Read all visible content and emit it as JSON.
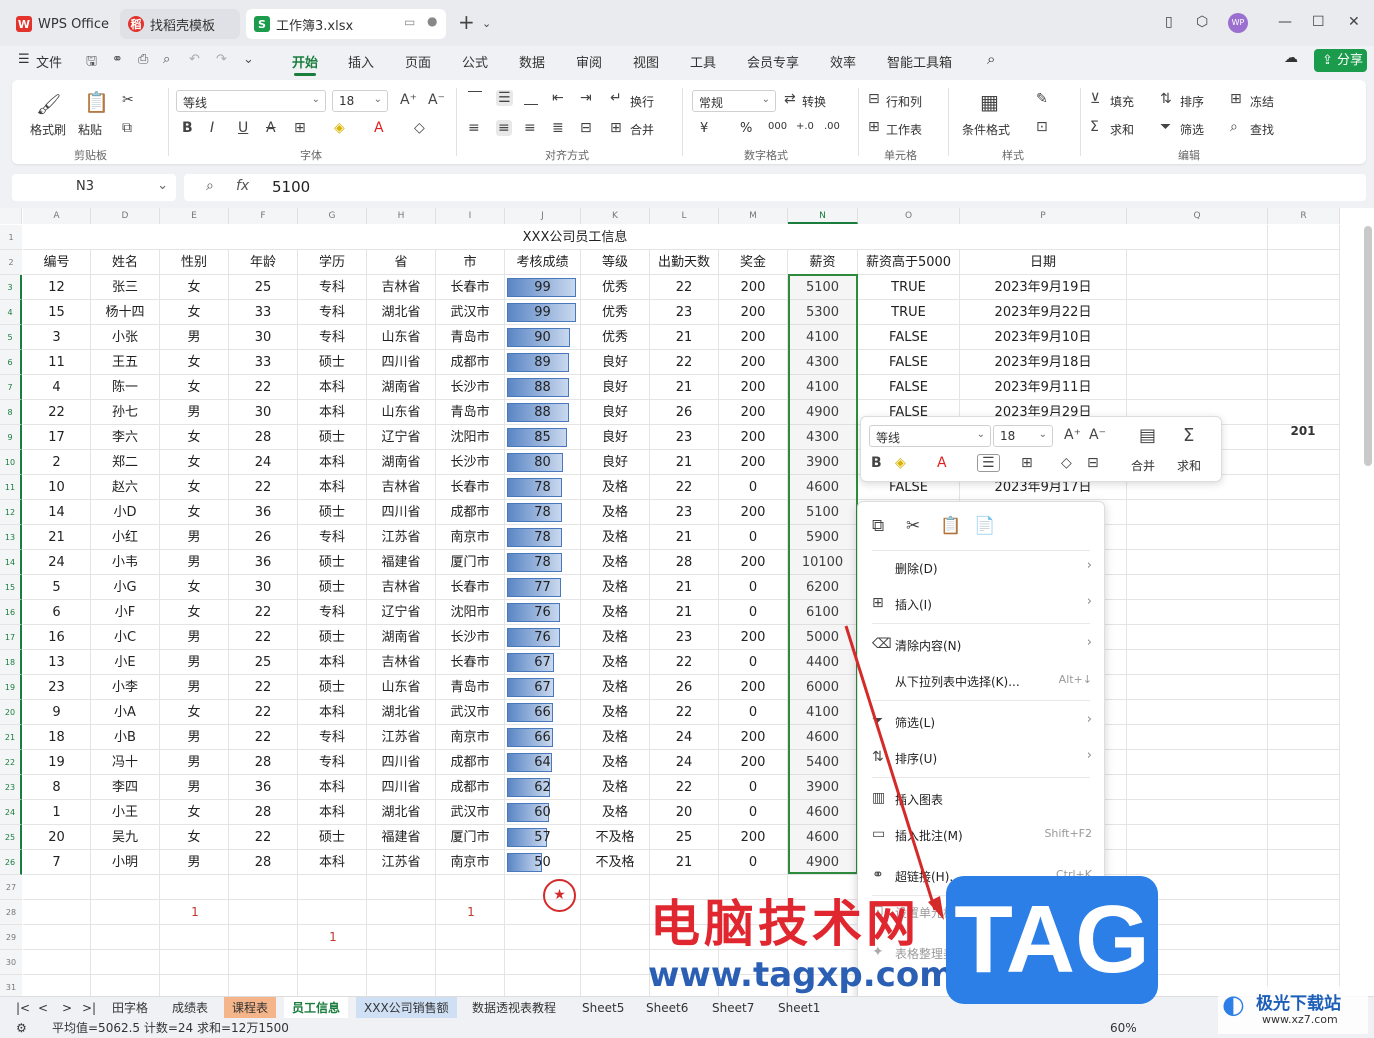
{
  "tabs": [
    {
      "label": "WPS Office",
      "logo": "W"
    },
    {
      "label": "找稻壳模板",
      "logo": "稻"
    },
    {
      "label": "工作簿3.xlsx",
      "logo": "S"
    }
  ],
  "menu": {
    "file": "文件",
    "items": [
      "开始",
      "插入",
      "页面",
      "公式",
      "数据",
      "审阅",
      "视图",
      "工具",
      "会员专享",
      "效率",
      "智能工具箱"
    ],
    "share": "分享"
  },
  "ribbon": {
    "clipboard": {
      "brush": "格式刷",
      "paste": "粘贴",
      "group": "剪贴板"
    },
    "font": {
      "name": "等线",
      "size": "18",
      "group": "字体"
    },
    "align": {
      "wrap": "换行",
      "merge": "合并",
      "group": "对齐方式"
    },
    "number": {
      "format": "常规",
      "convert": "转换",
      "group": "数字格式",
      "yen": "¥",
      "pct": "%",
      "thousand": "000",
      "inc": "+.0",
      "dec": ".00"
    },
    "cells": {
      "rowcol": "行和列",
      "sheet": "工作表",
      "group": "单元格"
    },
    "styles": {
      "cond": "条件格式",
      "group": "样式"
    },
    "edit": {
      "fill": "填充",
      "sort": "排序",
      "freeze": "冻结",
      "sum": "求和",
      "filter": "筛选",
      "find": "查找",
      "group": "编辑"
    }
  },
  "formula": {
    "name": "N3",
    "fx": "fx",
    "value": "5100"
  },
  "columns": [
    "A",
    "D",
    "E",
    "F",
    "G",
    "H",
    "I",
    "J",
    "K",
    "L",
    "M",
    "N",
    "O",
    "P",
    "Q",
    "R"
  ],
  "title_row": "XXX公司员工信息",
  "headers": [
    "编号",
    "姓名",
    "性别",
    "年龄",
    "学历",
    "省",
    "市",
    "考核成绩",
    "等级",
    "出勤天数",
    "奖金",
    "薪资",
    "薪资高于5000",
    "日期"
  ],
  "rows": [
    [
      "12",
      "张三",
      "女",
      "25",
      "专科",
      "吉林省",
      "长春市",
      "99",
      "优秀",
      "22",
      "200",
      "5100",
      "TRUE",
      "2023年9月19日"
    ],
    [
      "15",
      "杨十四",
      "女",
      "33",
      "专科",
      "湖北省",
      "武汉市",
      "99",
      "优秀",
      "23",
      "200",
      "5300",
      "TRUE",
      "2023年9月22日"
    ],
    [
      "3",
      "小张",
      "男",
      "30",
      "专科",
      "山东省",
      "青岛市",
      "90",
      "优秀",
      "21",
      "200",
      "4100",
      "FALSE",
      "2023年9月10日"
    ],
    [
      "11",
      "王五",
      "女",
      "33",
      "硕士",
      "四川省",
      "成都市",
      "89",
      "良好",
      "22",
      "200",
      "4300",
      "FALSE",
      "2023年9月18日"
    ],
    [
      "4",
      "陈一",
      "女",
      "22",
      "本科",
      "湖南省",
      "长沙市",
      "88",
      "良好",
      "21",
      "200",
      "4100",
      "FALSE",
      "2023年9月11日"
    ],
    [
      "22",
      "孙七",
      "男",
      "30",
      "本科",
      "山东省",
      "青岛市",
      "88",
      "良好",
      "26",
      "200",
      "4900",
      "FALSE",
      "2023年9月29日"
    ],
    [
      "17",
      "李六",
      "女",
      "28",
      "硕士",
      "辽宁省",
      "沈阳市",
      "85",
      "良好",
      "23",
      "200",
      "4300",
      "",
      ""
    ],
    [
      "2",
      "郑二",
      "女",
      "24",
      "本科",
      "湖南省",
      "长沙市",
      "80",
      "良好",
      "21",
      "200",
      "3900",
      "",
      ""
    ],
    [
      "10",
      "赵六",
      "女",
      "22",
      "本科",
      "吉林省",
      "长春市",
      "78",
      "及格",
      "22",
      "0",
      "4600",
      "FALSE",
      "2023年9月17日"
    ],
    [
      "14",
      "小D",
      "女",
      "36",
      "硕士",
      "四川省",
      "成都市",
      "78",
      "及格",
      "23",
      "200",
      "5100",
      "",
      ""
    ],
    [
      "21",
      "小红",
      "男",
      "26",
      "专科",
      "江苏省",
      "南京市",
      "78",
      "及格",
      "21",
      "0",
      "5900",
      "",
      ""
    ],
    [
      "24",
      "小韦",
      "男",
      "36",
      "硕士",
      "福建省",
      "厦门市",
      "78",
      "及格",
      "28",
      "200",
      "10100",
      "",
      ""
    ],
    [
      "5",
      "小G",
      "女",
      "30",
      "硕士",
      "吉林省",
      "长春市",
      "77",
      "及格",
      "21",
      "0",
      "6200",
      "",
      ""
    ],
    [
      "6",
      "小F",
      "女",
      "22",
      "专科",
      "辽宁省",
      "沈阳市",
      "76",
      "及格",
      "21",
      "0",
      "6100",
      "",
      ""
    ],
    [
      "16",
      "小C",
      "男",
      "22",
      "硕士",
      "湖南省",
      "长沙市",
      "76",
      "及格",
      "23",
      "200",
      "5000",
      "",
      ""
    ],
    [
      "13",
      "小E",
      "男",
      "25",
      "本科",
      "吉林省",
      "长春市",
      "67",
      "及格",
      "22",
      "0",
      "4400",
      "",
      ""
    ],
    [
      "23",
      "小李",
      "男",
      "22",
      "硕士",
      "山东省",
      "青岛市",
      "67",
      "及格",
      "26",
      "200",
      "6000",
      "",
      ""
    ],
    [
      "9",
      "小A",
      "女",
      "22",
      "本科",
      "湖北省",
      "武汉市",
      "66",
      "及格",
      "22",
      "0",
      "4100",
      "",
      ""
    ],
    [
      "18",
      "小B",
      "男",
      "22",
      "专科",
      "江苏省",
      "南京市",
      "66",
      "及格",
      "24",
      "200",
      "4600",
      "",
      ""
    ],
    [
      "19",
      "冯十",
      "男",
      "28",
      "专科",
      "四川省",
      "成都市",
      "64",
      "及格",
      "24",
      "200",
      "5400",
      "",
      ""
    ],
    [
      "8",
      "李四",
      "男",
      "36",
      "本科",
      "四川省",
      "成都市",
      "62",
      "及格",
      "22",
      "0",
      "3900",
      "",
      ""
    ],
    [
      "1",
      "小王",
      "女",
      "28",
      "本科",
      "湖北省",
      "武汉市",
      "60",
      "及格",
      "20",
      "0",
      "4600",
      "",
      ""
    ],
    [
      "20",
      "吴九",
      "女",
      "22",
      "硕士",
      "福建省",
      "厦门市",
      "57",
      "不及格",
      "25",
      "200",
      "4600",
      "",
      ""
    ],
    [
      "7",
      "小明",
      "男",
      "28",
      "本科",
      "江苏省",
      "南京市",
      "50",
      "不及格",
      "21",
      "0",
      "4900",
      "",
      ""
    ]
  ],
  "row_numbers": [
    "1",
    "2",
    "3",
    "4",
    "5",
    "6",
    "7",
    "8",
    "9",
    "10",
    "11",
    "12",
    "13",
    "14",
    "15",
    "16",
    "17",
    "18",
    "19",
    "20",
    "21",
    "22",
    "23",
    "24",
    "25",
    "26",
    "27",
    "28",
    "29",
    "30",
    "31"
  ],
  "extra": {
    "r_cell": "201",
    "e28": "1",
    "i28": "1",
    "g29": "1"
  },
  "sheets": [
    "田字格",
    "成绩表",
    "课程表",
    "员工信息",
    "XXX公司销售额",
    "数据透视表教程",
    "Sheet5",
    "Sheet6",
    "Sheet7",
    "Sheet1"
  ],
  "status": {
    "text": "平均值=5062.5  计数=24  求和=12万1500",
    "zoom": "60%"
  },
  "mini_toolbar": {
    "font": "等线",
    "size": "18",
    "merge": "合并",
    "sum": "求和"
  },
  "context_menu": [
    {
      "label": "删除(D)",
      "shortcut": "",
      "arrow": true
    },
    {
      "label": "插入(I)",
      "shortcut": "",
      "arrow": true
    },
    {
      "label": "清除内容(N)",
      "shortcut": "",
      "arrow": true
    },
    {
      "label": "从下拉列表中选择(K)...",
      "shortcut": "Alt+↓",
      "arrow": false
    },
    {
      "label": "筛选(L)",
      "shortcut": "",
      "arrow": true
    },
    {
      "label": "排序(U)",
      "shortcut": "",
      "arrow": true
    },
    {
      "label": "插入图表",
      "shortcut": "",
      "arrow": false
    },
    {
      "label": "插入批注(M)",
      "shortcut": "Shift+F2",
      "arrow": false
    },
    {
      "label": "超链接(H)...",
      "shortcut": "Ctrl+K",
      "arrow": false
    },
    {
      "label": "设置单元格格式(F)...",
      "shortcut": "Ctrl+1",
      "arrow": false
    },
    {
      "label": "表格整理美化",
      "shortcut": "",
      "arrow": false
    }
  ],
  "watermark": {
    "cn": "电脑技术网",
    "url": "www.tagxp.com",
    "tag": "TAG",
    "brand": "极光下载站",
    "brand_url": "www.xz7.com"
  },
  "colors": {
    "accent": "#1a7d3e",
    "bar": "#5a86c5",
    "selection": "#2e8b3e",
    "watermark_red": "#e0262e",
    "watermark_blue": "#2b5fb4"
  }
}
